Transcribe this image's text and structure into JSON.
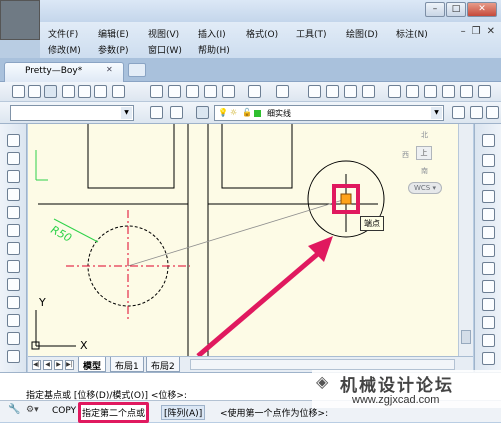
{
  "window": {
    "minimize": "–",
    "maximize": "□",
    "close": "✕",
    "mdi_min": "–",
    "mdi_restore": "❐",
    "mdi_close": "✕"
  },
  "menu": {
    "row1": [
      "文件(F)",
      "编辑(E)",
      "视图(V)",
      "插入(I)",
      "格式(O)",
      "工具(T)",
      "绘图(D)",
      "标注(N)"
    ],
    "row2": [
      "修改(M)",
      "参数(P)",
      "窗口(W)",
      "帮助(H)"
    ]
  },
  "tab": {
    "label": "Pretty—Boy*",
    "close": "✕"
  },
  "toolbar2": {
    "linetype_label": "细实线"
  },
  "viewcube": {
    "north": "北",
    "south": "南",
    "west": "西",
    "top": "上",
    "wcs": "WCS ▾"
  },
  "drawing": {
    "dimension_label": "R50",
    "tooltip": "端点",
    "ucs_y": "Y",
    "ucs_x": "X",
    "line_color": "#000000",
    "center_line_color": "#e0002a",
    "dimension_color": "#2fd24a",
    "highlight_color": "#e0195f"
  },
  "layout_tabs": {
    "nav": [
      "◀|",
      "◀",
      "▶",
      "▶|"
    ],
    "tabs": [
      "模型",
      "布局1",
      "布局2"
    ]
  },
  "command": {
    "line1": "指定基点或 [位移(D)/模式(O)] <位移>:",
    "line2_prefix": "COPY",
    "line2_highlight": "指定第二个点或",
    "line2_option": "[阵列(A)]",
    "line2_suffix": "<使用第一个点作为位移>:"
  },
  "watermark": {
    "title": "机械设计论坛",
    "url": "www.zgjxcad.com"
  }
}
